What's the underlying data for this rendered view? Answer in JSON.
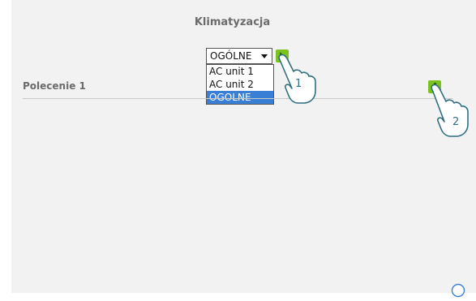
{
  "page": {
    "title": "Klimatyzacja"
  },
  "selector": {
    "value": "OGÓLNE",
    "options": [
      "AC unit 1",
      "AC unit 2",
      "OGOLNE"
    ],
    "selected_index": 2
  },
  "rows": [
    {
      "label": "Polecenie 1"
    }
  ],
  "callouts": [
    "1",
    "2"
  ],
  "icons": {
    "go": "arrow-right-icon",
    "add": "plus-icon",
    "help": "help-icon"
  },
  "colors": {
    "accent_green": "#7cc21c",
    "select_highlight": "#3a7fd6",
    "callout": "#2f6f80"
  }
}
